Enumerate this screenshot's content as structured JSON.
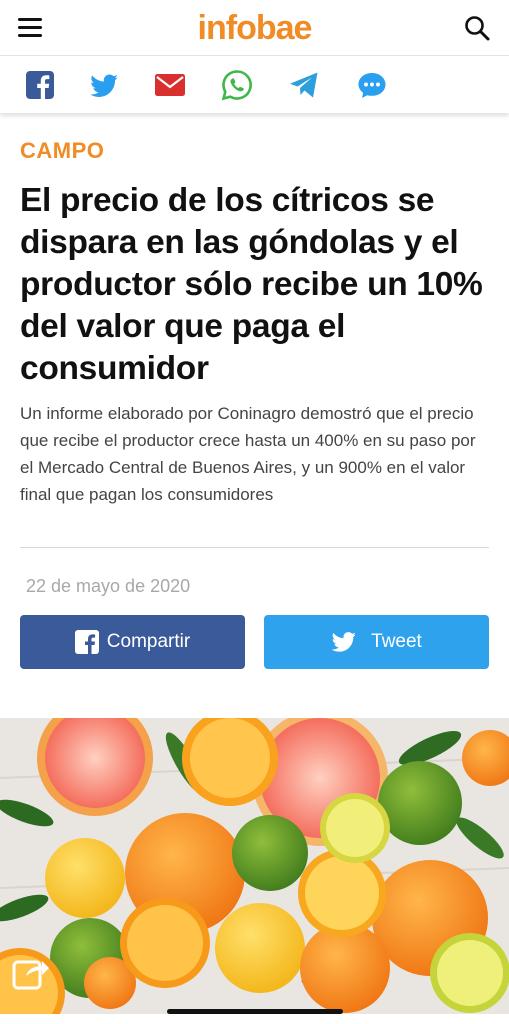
{
  "header": {
    "logo": "infobae",
    "menu_icon": "hamburger-menu-icon",
    "search_icon": "search-icon",
    "brand_color": "#f18b26"
  },
  "share_bar": {
    "icons": [
      "facebook-icon",
      "twitter-icon",
      "email-icon",
      "whatsapp-icon",
      "telegram-icon",
      "messenger-icon"
    ]
  },
  "article": {
    "section": "CAMPO",
    "title": "El precio de los cítricos se dispara en las góndolas y el productor sólo recibe un 10% del valor que paga el consumidor",
    "subtitle": "Un informe elaborado por Coninagro demostró que el precio que recibe el productor crece hasta un 400% en su paso por el Mercado Central de Buenos Aires, y un 900% en el valor final que pagan los consumidores",
    "date": "22 de mayo de 2020"
  },
  "buttons": {
    "facebook_label": "Compartir",
    "twitter_label": "Tweet",
    "facebook_color": "#3b5a9a",
    "twitter_color": "#2fa2ee"
  },
  "hero": {
    "subject": "citrus fruits: oranges, lemons, limes, grapefruit with leaves",
    "share_icon": "share-icon"
  }
}
